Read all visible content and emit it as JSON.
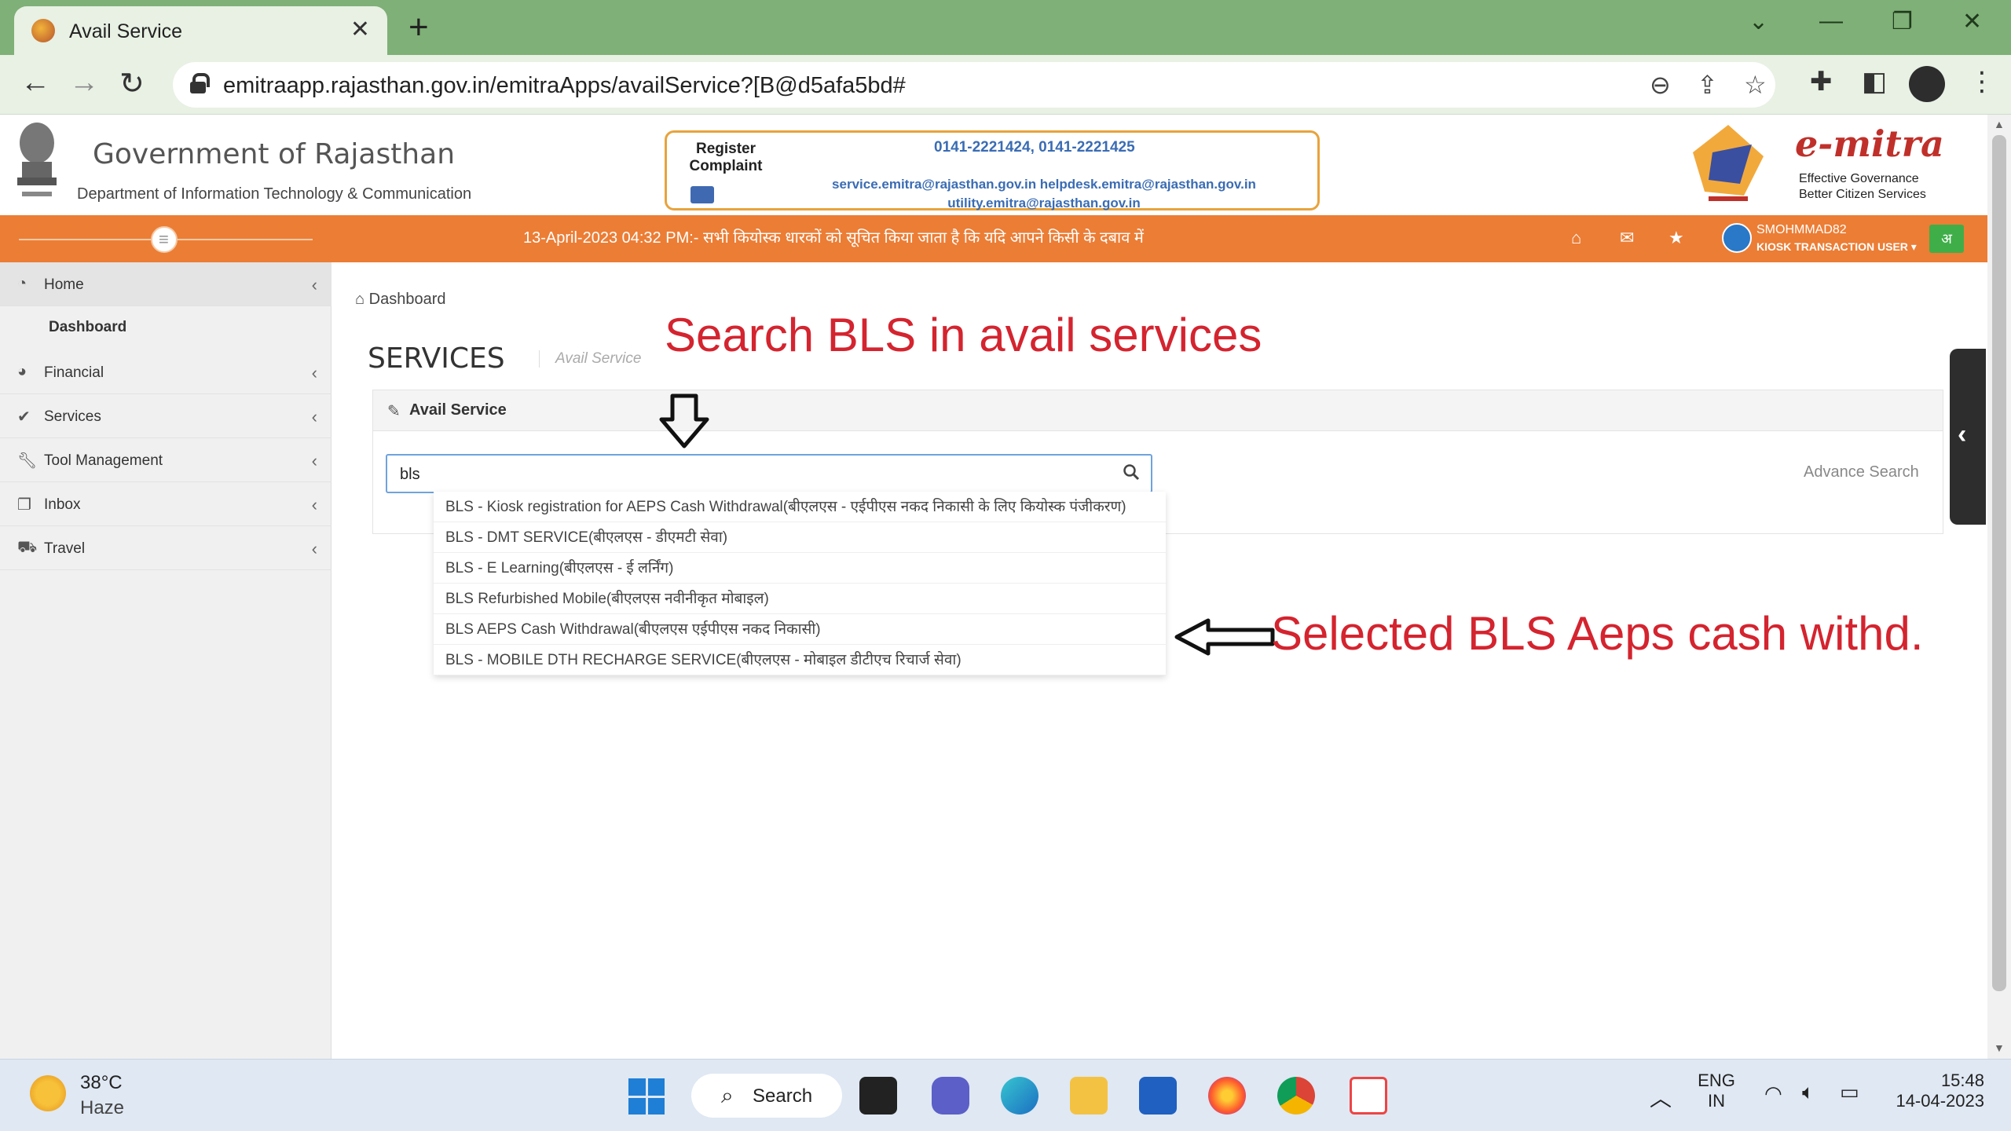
{
  "browser": {
    "tab_title": "Avail Service",
    "url": "emitraapp.rajasthan.gov.in/emitraApps/availService?[B@d5afa5bd#"
  },
  "header": {
    "gov_title": "Government of Rajasthan",
    "gov_subtitle": "Department of Information Technology & Communication",
    "complaint_label": "Register Complaint",
    "phones": "0141-2221424, 0141-2221425",
    "emails_line1": "service.emitra@rajasthan.gov.in helpdesk.emitra@rajasthan.gov.in",
    "emails_line2": "utility.emitra@rajasthan.gov.in",
    "brand": "e-mitra",
    "tagline_line1": "Effective Governance",
    "tagline_line2": "Better Citizen Services"
  },
  "notice": {
    "ticker": "13-April-2023 04:32 PM:- सभी कियोस्क धारकों को सूचित किया जाता है कि यदि आपने किसी के दबाव में",
    "user_name": "SMOHMMAD82",
    "user_role": "KIOSK TRANSACTION USER ▾",
    "lang": "अ"
  },
  "sidebar": {
    "items": [
      {
        "label": "Home"
      },
      {
        "label": "Financial"
      },
      {
        "label": "Services"
      },
      {
        "label": "Tool Management"
      },
      {
        "label": "Inbox"
      },
      {
        "label": "Travel"
      }
    ],
    "sub_dashboard": "Dashboard"
  },
  "main": {
    "breadcrumb": "Dashboard",
    "title": "SERVICES",
    "subtitle": "Avail Service",
    "panel_title": "Avail Service",
    "search_value": "bls",
    "advance_search": "Advance Search",
    "suggestions": [
      "BLS - Kiosk registration for AEPS Cash Withdrawal(बीएलएस - एईपीएस नकद निकासी के लिए कियोस्क पंजीकरण)",
      "BLS - DMT SERVICE(बीएलएस - डीएमटी सेवा)",
      "BLS - E Learning(बीएलएस - ई लर्निंग)",
      "BLS Refurbished Mobile(बीएलएस नवीनीकृत मोबाइल)",
      "BLS AEPS Cash Withdrawal(बीएलएस एईपीएस नकद निकासी)",
      "BLS - MOBILE DTH RECHARGE SERVICE(बीएलएस - मोबाइल डीटीएच रिचार्ज सेवा)"
    ]
  },
  "annotations": {
    "top": "Search BLS in avail services",
    "right": "Selected BLS Aeps cash withd."
  },
  "taskbar": {
    "temp": "38°C",
    "weather": "Haze",
    "search": "Search",
    "lang1": "ENG",
    "lang2": "IN",
    "time": "15:48",
    "date": "14-04-2023"
  }
}
